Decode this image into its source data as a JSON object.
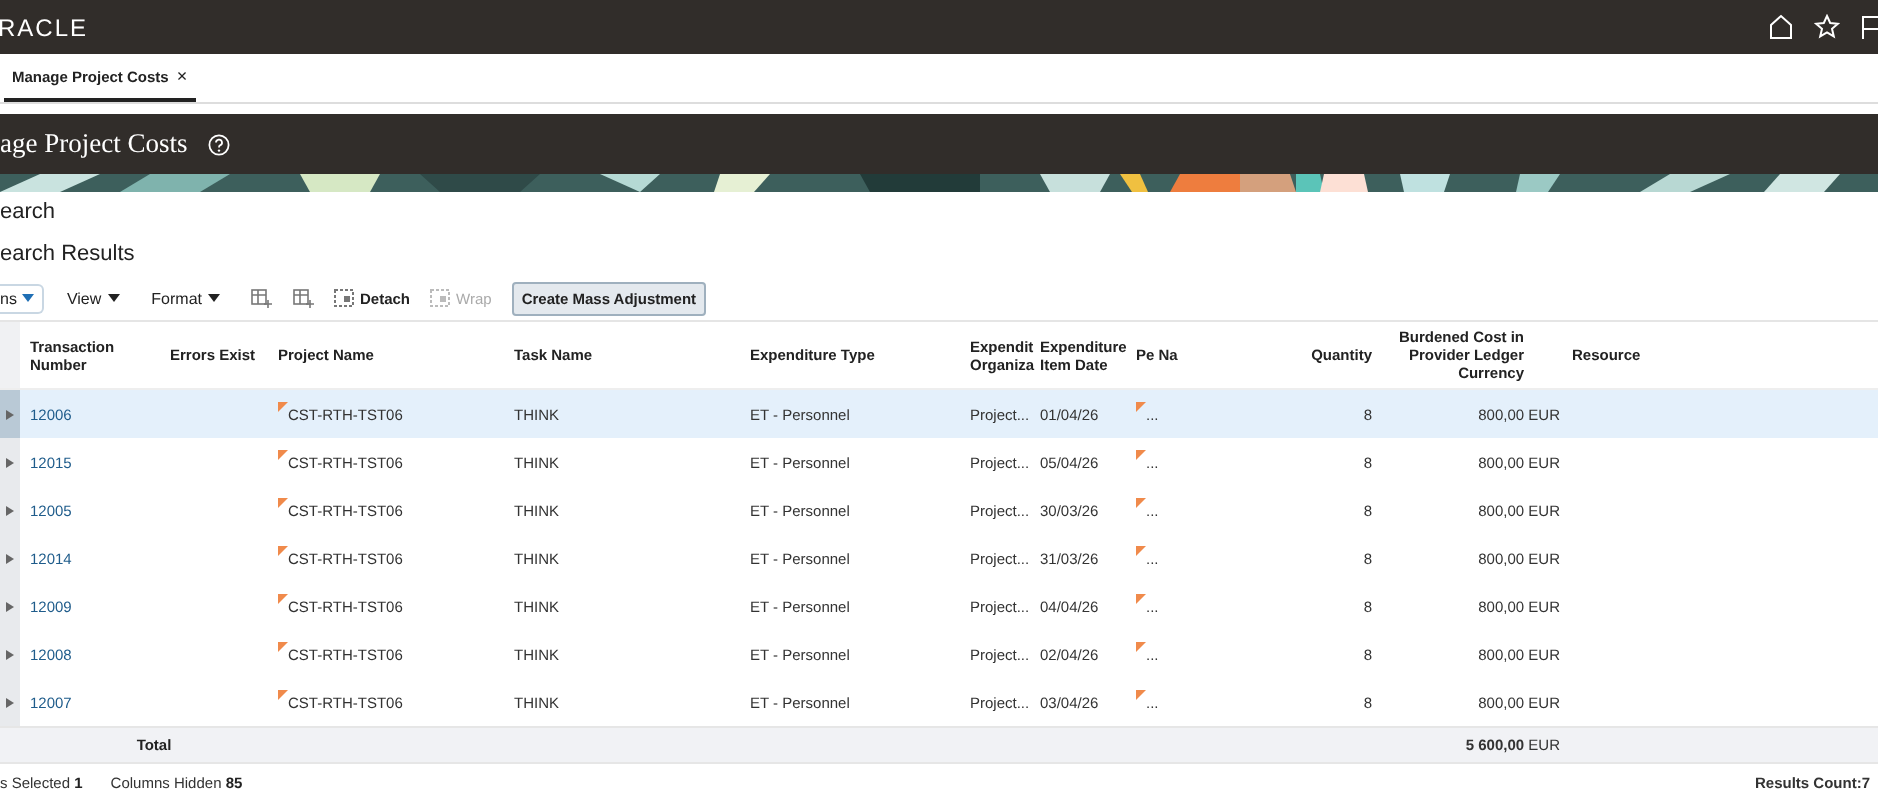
{
  "header": {
    "logo": "RACLE"
  },
  "tabs": [
    {
      "label": "Manage Project Costs",
      "selected": true,
      "close": "×"
    }
  ],
  "page_title": "age Project Costs",
  "search_heading": "earch",
  "results_heading": "earch Results",
  "toolbar": [
    {
      "kind": "menu",
      "label": "ns",
      "highlighted": true
    },
    {
      "kind": "menu",
      "label": "View",
      "highlighted": false
    },
    {
      "kind": "menu",
      "label": "Format",
      "highlighted": false
    },
    {
      "kind": "icon"
    },
    {
      "kind": "icon"
    },
    {
      "kind": "action",
      "label": "Detach",
      "disabled": false
    },
    {
      "kind": "action",
      "label": "Wrap",
      "disabled": true
    },
    {
      "kind": "button",
      "label": "Create Mass Adjustment"
    }
  ],
  "table": {
    "columns": [
      "Transaction Number",
      "Errors Exist",
      "Project Name",
      "Task Name",
      "Expenditure Type",
      "Expendit Organiza",
      "Expenditure Item Date",
      "Pe Na",
      "Quantity",
      "Burdened Cost in Provider Ledger Currency",
      "Resource"
    ],
    "rows": [
      {
        "selected": true,
        "number": "12006",
        "project": "CST-RTH-TST06",
        "task": "THINK",
        "type": "ET - Personnel",
        "org": "Project...",
        "date": "01/04/26",
        "pe": "...",
        "quantity": "8",
        "cost": "800,00 EUR"
      },
      {
        "selected": false,
        "number": "12015",
        "project": "CST-RTH-TST06",
        "task": "THINK",
        "type": "ET - Personnel",
        "org": "Project...",
        "date": "05/04/26",
        "pe": "...",
        "quantity": "8",
        "cost": "800,00 EUR"
      },
      {
        "selected": false,
        "number": "12005",
        "project": "CST-RTH-TST06",
        "task": "THINK",
        "type": "ET - Personnel",
        "org": "Project...",
        "date": "30/03/26",
        "pe": "...",
        "quantity": "8",
        "cost": "800,00 EUR"
      },
      {
        "selected": false,
        "number": "12014",
        "project": "CST-RTH-TST06",
        "task": "THINK",
        "type": "ET - Personnel",
        "org": "Project...",
        "date": "31/03/26",
        "pe": "...",
        "quantity": "8",
        "cost": "800,00 EUR"
      },
      {
        "selected": false,
        "number": "12009",
        "project": "CST-RTH-TST06",
        "task": "THINK",
        "type": "ET - Personnel",
        "org": "Project...",
        "date": "04/04/26",
        "pe": "...",
        "quantity": "8",
        "cost": "800,00 EUR"
      },
      {
        "selected": false,
        "number": "12008",
        "project": "CST-RTH-TST06",
        "task": "THINK",
        "type": "ET - Personnel",
        "org": "Project...",
        "date": "02/04/26",
        "pe": "...",
        "quantity": "8",
        "cost": "800,00 EUR"
      },
      {
        "selected": false,
        "number": "12007",
        "project": "CST-RTH-TST06",
        "task": "THINK",
        "type": "ET - Personnel",
        "org": "Project...",
        "date": "03/04/26",
        "pe": "...",
        "quantity": "8",
        "cost": "800,00 EUR"
      }
    ],
    "total_label": "Total",
    "total_cost": "**5 600,00** EUR"
  },
  "status": {
    "selected_label": "s Selected",
    "selected_count": "1",
    "hidden_label": "Columns Hidden",
    "hidden_count": "85",
    "results": "Results Count:7"
  }
}
